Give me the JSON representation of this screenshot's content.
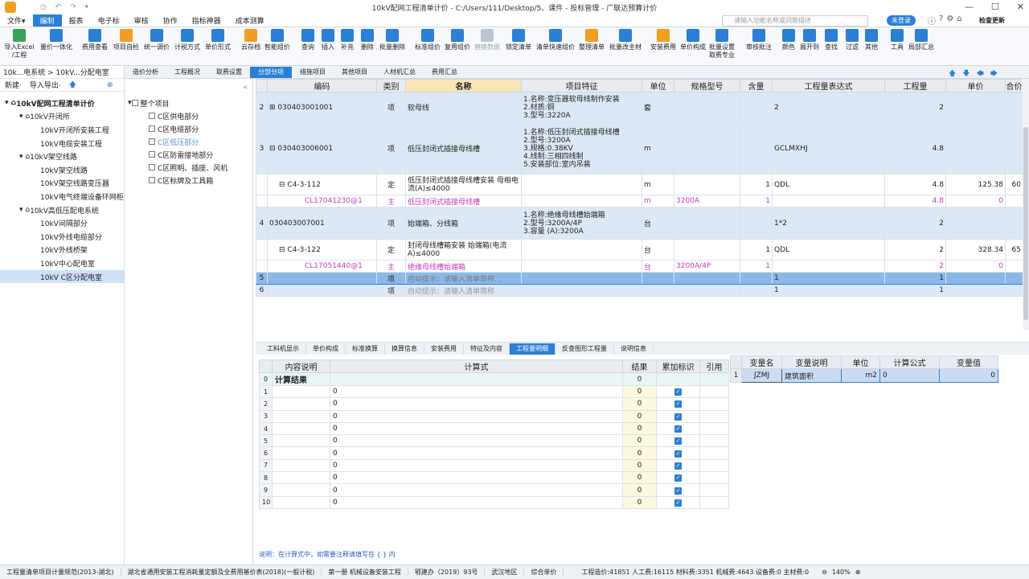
{
  "titlebar": {
    "title": "10kV配网工程清单计价 - C:/Users/111/Desktop/5、课件 - 投标管理 - 广联达预算计价"
  },
  "menu": {
    "items": [
      "文件▾",
      "编制",
      "报表",
      "电子标",
      "审核",
      "协作",
      "指标神器",
      "成本测算"
    ],
    "search_placeholder": "请输入功能名称或问题描述",
    "login": "未登录",
    "check_update": "检查更新"
  },
  "ribbon": [
    {
      "label": "导入Excel\n/工程",
      "icon": "import-excel-icon"
    },
    {
      "label": "量价一体化",
      "icon": "integration-icon"
    },
    {
      "label": "费用查看",
      "icon": "fee-view-icon"
    },
    {
      "label": "项目自检",
      "icon": "self-check-icon"
    },
    {
      "label": "统一调价",
      "icon": "price-adjust-icon"
    },
    {
      "label": "计税方式",
      "icon": "tax-icon"
    },
    {
      "label": "单价形式",
      "icon": "unit-price-icon"
    },
    {
      "label": "云存档",
      "icon": "cloud-save-icon"
    },
    {
      "label": "智能组价",
      "icon": "smart-price-icon"
    },
    {
      "label": "查询",
      "icon": "query-icon"
    },
    {
      "label": "插入",
      "icon": "insert-icon"
    },
    {
      "label": "补充",
      "icon": "supplement-icon"
    },
    {
      "label": "删除",
      "icon": "delete-icon"
    },
    {
      "label": "批量删除",
      "icon": "batch-delete-icon"
    },
    {
      "label": "标准组价",
      "icon": "standard-price-icon"
    },
    {
      "label": "复用组价",
      "icon": "reuse-price-icon"
    },
    {
      "label": "替换数据",
      "icon": "replace-data-icon"
    },
    {
      "label": "锁定清单",
      "icon": "lock-icon"
    },
    {
      "label": "清单快速组价",
      "icon": "quick-price-icon"
    },
    {
      "label": "整理清单",
      "icon": "organize-icon"
    },
    {
      "label": "批量改主材",
      "icon": "batch-material-icon"
    },
    {
      "label": "安装费用",
      "icon": "install-fee-icon"
    },
    {
      "label": "单价构成",
      "icon": "price-compose-icon"
    },
    {
      "label": "批量设置\n取费专业",
      "icon": "batch-setting-icon"
    },
    {
      "label": "审核批注",
      "icon": "review-icon"
    },
    {
      "label": "颜色",
      "icon": "color-icon"
    },
    {
      "label": "展开到",
      "icon": "expand-icon"
    },
    {
      "label": "查找",
      "icon": "find-icon"
    },
    {
      "label": "过滤",
      "icon": "filter-icon"
    },
    {
      "label": "其他",
      "icon": "other-icon"
    },
    {
      "label": "工具",
      "icon": "tool-icon"
    },
    {
      "label": "局部汇总",
      "icon": "partial-sum-icon"
    }
  ],
  "left": {
    "breadcrumb": "10k...电系统 > 10kV...分配电室",
    "new_label": "新建·",
    "import_export": "导入导出·",
    "tree": [
      {
        "label": "10kV配网工程清单计价",
        "level": 0
      },
      {
        "label": "10kV开闭所",
        "level": 1
      },
      {
        "label": "10kV开闭所安装工程",
        "level": 2
      },
      {
        "label": "10kV电缆安装工程",
        "level": 2
      },
      {
        "label": "10kV架空线路",
        "level": 1
      },
      {
        "label": "10kV架空线路",
        "level": 2
      },
      {
        "label": "10kV架空线路变压器",
        "level": 2
      },
      {
        "label": "10kV电气终端设备环网柜...",
        "level": 2
      },
      {
        "label": "10kV高低压配电系统",
        "level": 1
      },
      {
        "label": "10kV间隔部分",
        "level": 2
      },
      {
        "label": "10kV外线电缆部分",
        "level": 2
      },
      {
        "label": "10kV外线桥架",
        "level": 2
      },
      {
        "label": "10kV中心配电室",
        "level": 2
      },
      {
        "label": "10kV C区分配电室",
        "level": 2
      }
    ]
  },
  "mid": {
    "items": [
      {
        "label": "整个项目"
      },
      {
        "label": "C区供电部分"
      },
      {
        "label": "C区电缆部分"
      },
      {
        "label": "C区低压部分"
      },
      {
        "label": "C区防雷接地部分"
      },
      {
        "label": "C区照明、插座、风机"
      },
      {
        "label": "C区标牌及工具箱"
      }
    ]
  },
  "tabs": [
    "造价分析",
    "工程概况",
    "取费设置",
    "分部分项",
    "措施项目",
    "其他项目",
    "人材机汇总",
    "费用汇总"
  ],
  "grid": {
    "headers": [
      "",
      "编码",
      "类别",
      "名称",
      "项目特征",
      "单位",
      "规格型号",
      "含量",
      "工程量表达式",
      "工程量",
      "单价",
      "合价"
    ],
    "rows": [
      {
        "no": "2",
        "code": "030403001001",
        "cat": "项",
        "name": "软母线",
        "feat": "1.名称:变压器软母线制作安装\n2.材质:铜\n3.型号:3220A",
        "unit": "套",
        "spec": "",
        "qty_ratio": "",
        "expr": "2",
        "qty": "2",
        "price": "",
        "total": ""
      },
      {
        "no": "3",
        "code": "030403006001",
        "cat": "项",
        "name": "低压封闭式插接母线槽",
        "feat": "1.名称:低压封闭式插接母线槽\n2.型号:3200A\n3.规格:0.38KV\n4.线制:三相四线制\n5.安装部位:室内吊装",
        "unit": "m",
        "spec": "",
        "qty_ratio": "",
        "expr": "GCLMXHJ",
        "qty": "4.8",
        "price": "",
        "total": ""
      },
      {
        "no": "",
        "code": "C4-3-112",
        "cat": "定",
        "name": "低压封闭式插接母线槽安装 母相电流(A)≤4000",
        "feat": "",
        "unit": "m",
        "spec": "",
        "qty_ratio": "1",
        "expr": "QDL",
        "qty": "4.8",
        "price": "125.38",
        "total": "60"
      },
      {
        "no": "",
        "code": "CL17041230@1",
        "cat": "主",
        "name": "低压封闭式插接母线槽",
        "feat": "",
        "unit": "m",
        "spec": "3200A",
        "qty_ratio": "1",
        "expr": "",
        "qty": "4.8",
        "price": "0",
        "total": ""
      },
      {
        "no": "4",
        "code": "030403007001",
        "cat": "项",
        "name": "始端箱、分线箱",
        "feat": "1.名称:绝缘母线槽始端箱\n2.型号:3200A/4P\n3.容量 (A):3200A",
        "unit": "台",
        "spec": "",
        "qty_ratio": "",
        "expr": "1*2",
        "qty": "2",
        "price": "",
        "total": ""
      },
      {
        "no": "",
        "code": "C4-3-122",
        "cat": "定",
        "name": "封闭母线槽箱安装 始端箱(电流A)≤4000",
        "feat": "",
        "unit": "台",
        "spec": "",
        "qty_ratio": "1",
        "expr": "QDL",
        "qty": "2",
        "price": "328.34",
        "total": "65"
      },
      {
        "no": "",
        "code": "CL17051440@1",
        "cat": "主",
        "name": "绝缘母线槽始端箱",
        "feat": "",
        "unit": "台",
        "spec": "3200A/4P",
        "qty_ratio": "1",
        "expr": "",
        "qty": "2",
        "price": "0",
        "total": ""
      },
      {
        "no": "5",
        "code": "",
        "cat": "项",
        "name": "自动提示：请输入清单简称…",
        "feat": "",
        "unit": "",
        "spec": "",
        "qty_ratio": "",
        "expr": "1",
        "qty": "1",
        "price": "",
        "total": ""
      },
      {
        "no": "6",
        "code": "",
        "cat": "项",
        "name": "自动提示：请输入清单简称",
        "feat": "",
        "unit": "",
        "spec": "",
        "qty_ratio": "",
        "expr": "1",
        "qty": "1",
        "price": "",
        "total": ""
      }
    ]
  },
  "bottom_tabs": [
    "工料机显示",
    "单价构成",
    "标准换算",
    "换算信息",
    "安装费用",
    "特征及内容",
    "工程量明细",
    "反查图形工程量",
    "说明信息"
  ],
  "calc": {
    "headers": [
      "",
      "内容说明",
      "计算式",
      "结果",
      "累加标识",
      "引用"
    ],
    "result_label": "计算结果",
    "rows": [
      {
        "idx": "0",
        "desc": "计算结果",
        "formula": "",
        "result": "0",
        "acc": false
      },
      {
        "idx": "1",
        "desc": "",
        "formula": "0",
        "result": "0",
        "acc": true
      },
      {
        "idx": "2",
        "desc": "",
        "formula": "0",
        "result": "0",
        "acc": true
      },
      {
        "idx": "3",
        "desc": "",
        "formula": "0",
        "result": "0",
        "acc": true
      },
      {
        "idx": "4",
        "desc": "",
        "formula": "0",
        "result": "0",
        "acc": true
      },
      {
        "idx": "5",
        "desc": "",
        "formula": "0",
        "result": "0",
        "acc": true
      },
      {
        "idx": "6",
        "desc": "",
        "formula": "0",
        "result": "0",
        "acc": true
      },
      {
        "idx": "7",
        "desc": "",
        "formula": "0",
        "result": "0",
        "acc": true
      },
      {
        "idx": "8",
        "desc": "",
        "formula": "0",
        "result": "0",
        "acc": true
      },
      {
        "idx": "9",
        "desc": "",
        "formula": "0",
        "result": "0",
        "acc": true
      },
      {
        "idx": "10",
        "desc": "",
        "formula": "0",
        "result": "0",
        "acc": true
      }
    ],
    "hint": "说明：在计算式中，如需要注释请填写在 { } 内"
  },
  "vars": {
    "headers": [
      "",
      "变量名",
      "变量说明",
      "单位",
      "计算公式",
      "变量值"
    ],
    "row": {
      "idx": "1",
      "name": "JZMJ",
      "desc": "建筑面积",
      "unit": "m2",
      "formula": "0",
      "value": "0"
    }
  },
  "status": {
    "items": [
      "工程量清单项目计量规范(2013-湖北)",
      "湖北省通用安装工程消耗量定额及全费用基价表(2018)(一般计税)",
      "第一册 机械设备安装工程",
      "鄂建办（2019）93号",
      "武汉地区",
      "综合单价"
    ],
    "cost": "工程造价:41851  人工费:16115  材料费:3351  机械费:4643  设备费:0  主材费:0",
    "zoom": "140%"
  }
}
